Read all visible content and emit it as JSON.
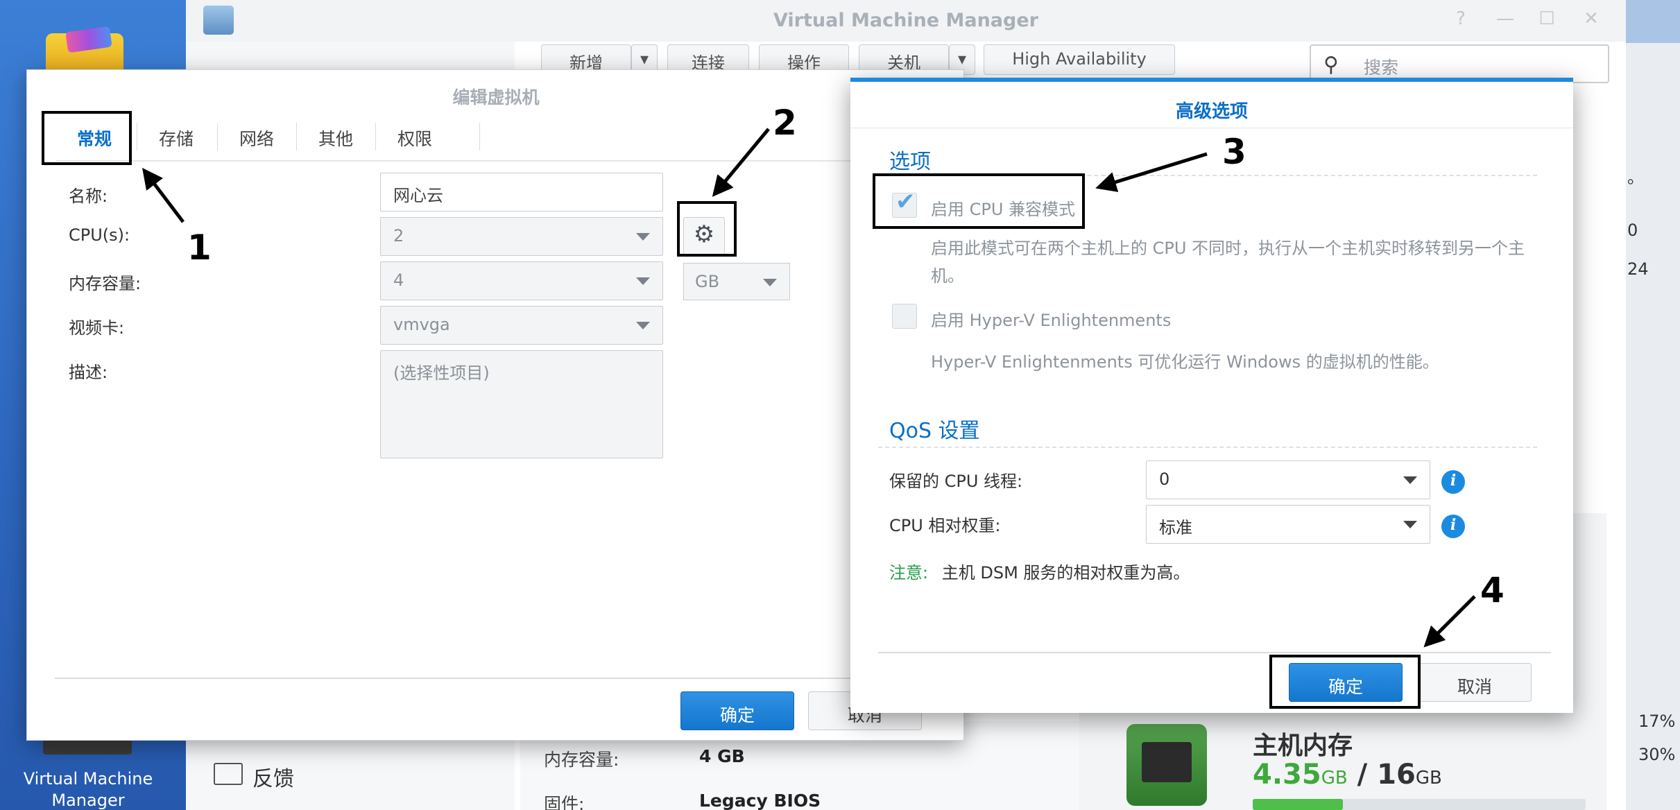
{
  "desktop": {
    "vmm_label": "Virtual Machine Manager"
  },
  "vmm": {
    "title": "Virtual Machine Manager",
    "window_controls": [
      "?",
      "—",
      "☐",
      "✕"
    ],
    "toolbar": {
      "create": "新增",
      "connect": "连接",
      "action": "操作",
      "shutdown": "关机",
      "high_availability": "High Availability"
    },
    "search_placeholder": "搜索",
    "sidebar_feedback": "反馈",
    "info": {
      "memory_label": "内存容量:",
      "memory_value": "4 GB",
      "firmware_label": "固件:",
      "firmware_value": "Legacy BIOS"
    },
    "host_memory": {
      "title": "主机内存",
      "used": "4.35",
      "used_unit": "GB",
      "separator": "/",
      "total": "16",
      "total_unit": "GB",
      "usage_fraction": 0.27
    },
    "right_strip": {
      "pct1": "17%",
      "pct2": "30%",
      "t1": "。",
      "t2": "0",
      "t3": "24"
    }
  },
  "edit_vm": {
    "title": "编辑虚拟机",
    "tabs": [
      "常规",
      "存储",
      "网络",
      "其他",
      "权限"
    ],
    "active_tab": 0,
    "fields": {
      "name_label": "名称:",
      "name_value": "网心云",
      "cpu_label": "CPU(s):",
      "cpu_value": "2",
      "memory_label": "内存容量:",
      "memory_value": "4",
      "memory_unit": "GB",
      "video_label": "视频卡:",
      "video_value": "vmvga",
      "desc_label": "描述:",
      "desc_placeholder": "(选择性项目)"
    },
    "ok": "确定",
    "cancel": "取消"
  },
  "advanced": {
    "title": "高级选项",
    "options_section": "选项",
    "cpu_compat_label": "启用 CPU 兼容模式",
    "cpu_compat_checked": true,
    "cpu_compat_desc": "启用此模式可在两个主机上的 CPU 不同时，执行从一个主机实时移转到另一个主机。",
    "hyperv_label": "启用 Hyper-V Enlightenments",
    "hyperv_checked": false,
    "hyperv_desc": "Hyper-V Enlightenments 可优化运行 Windows 的虚拟机的性能。",
    "qos_section": "QoS 设置",
    "reserved_cpu_label": "保留的 CPU 线程:",
    "reserved_cpu_value": "0",
    "cpu_weight_label": "CPU 相对权重:",
    "cpu_weight_value": "标准",
    "note_key": "注意:",
    "note_text": "主机 DSM 服务的相对权重为高。",
    "ok": "确定",
    "cancel": "取消"
  },
  "annotations": [
    "1",
    "2",
    "3",
    "4"
  ]
}
